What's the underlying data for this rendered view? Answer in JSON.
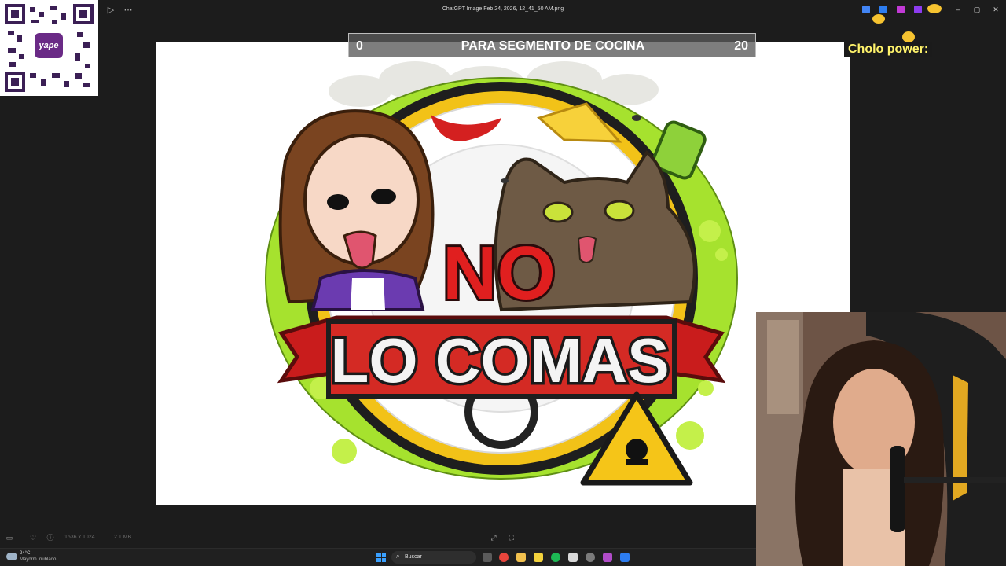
{
  "viewer": {
    "file_title": "ChatGPT Image Feb 24, 2026, 12_41_50 AM.png",
    "image_dimensions": "1536 x 1024",
    "file_size": "2.1 MB"
  },
  "overlay": {
    "score_left": "0",
    "score_title": "PARA SEGMENTO DE COCINA",
    "score_right": "20",
    "cholo_label": "Cholo power:",
    "qr_brand": "yape"
  },
  "artwork": {
    "word_no": "NO",
    "word_lo_comas": "LO COMAS"
  },
  "taskbar": {
    "weather_temp": "24°C",
    "weather_desc": "Mayorm. nublado",
    "search_label": "Buscar"
  },
  "colors": {
    "viewer_bg": "#1c1c1c",
    "overlay_text": "#fff36b",
    "logo_red": "#d71f1f",
    "slime_green": "#a6e22e",
    "yape_purple": "#6a2a86"
  }
}
